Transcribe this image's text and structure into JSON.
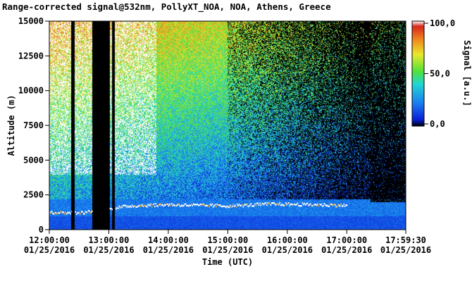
{
  "chart_data": {
    "type": "heatmap",
    "title": "Range-corrected signal@532nm, PollyXT_NOA, NOA, Athens, Greece",
    "xlabel": "Time (UTC)",
    "ylabel": "Altitude (m)",
    "colorbar_label": "Signal [a.u.]",
    "x_range": [
      "12:00:00",
      "17:59:30"
    ],
    "x_ticks": [
      {
        "time": "12:00:00",
        "date": "01/25/2016"
      },
      {
        "time": "13:00:00",
        "date": "01/25/2016"
      },
      {
        "time": "14:00:00",
        "date": "01/25/2016"
      },
      {
        "time": "15:00:00",
        "date": "01/25/2016"
      },
      {
        "time": "16:00:00",
        "date": "01/25/2016"
      },
      {
        "time": "17:00:00",
        "date": "01/25/2016"
      },
      {
        "time": "17:59:30",
        "date": "01/25/2016"
      }
    ],
    "y_range": [
      0,
      15000
    ],
    "y_ticks": [
      0,
      2500,
      5000,
      7500,
      10000,
      12500,
      15000
    ],
    "y_tick_labels": [
      "0",
      "2500",
      "5000",
      "7500",
      "10000",
      "12500",
      "15000"
    ],
    "colorbar_range": [
      0,
      100
    ],
    "colorbar_ticks": [
      0,
      50,
      100
    ],
    "colorbar_tick_labels": [
      "0,0",
      "50,0",
      "100,0"
    ],
    "colormap": [
      "#000000",
      "#0a1fd8",
      "#1a7ef0",
      "#22d6d2",
      "#4fe13a",
      "#e9e92c",
      "#f08a1e",
      "#d8261c",
      "#ffffff"
    ],
    "gaps": [
      {
        "start": "12:22:00",
        "end": "12:25:00"
      },
      {
        "start": "12:43:00",
        "end": "13:00:30"
      },
      {
        "start": "13:03:00",
        "end": "13:06:00"
      }
    ],
    "cloud_layer": [
      {
        "time": "12:00:00",
        "altitude": 1300
      },
      {
        "time": "12:30:00",
        "altitude": 1250
      },
      {
        "time": "13:20:00",
        "altitude": 1750
      },
      {
        "time": "14:00:00",
        "altitude": 1850
      },
      {
        "time": "15:00:00",
        "altitude": 1750
      },
      {
        "time": "15:45:00",
        "altitude": 1900
      },
      {
        "time": "17:00:00",
        "altitude": 1800
      }
    ]
  }
}
